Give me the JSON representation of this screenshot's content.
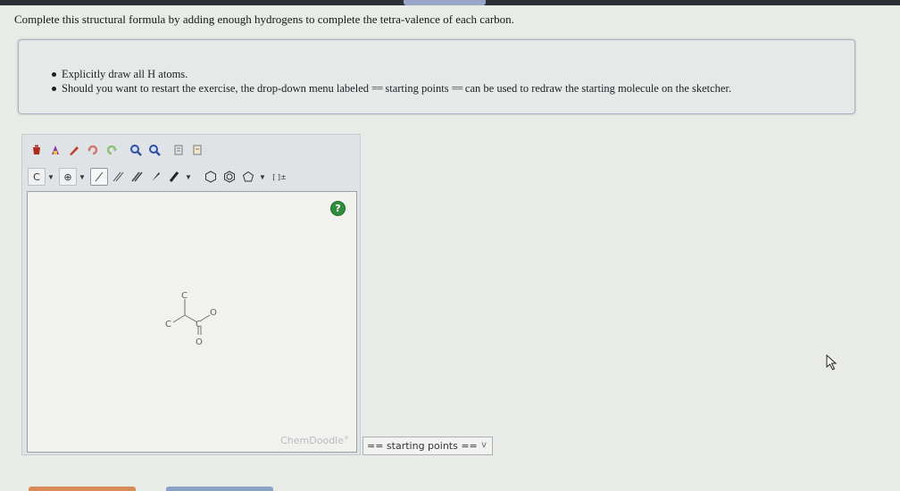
{
  "instruction": "Complete this structural formula by adding enough hydrogens to complete the tetra-valence of each carbon.",
  "info": {
    "bullet1": "Explicitly draw all H atoms.",
    "bullet2_pre": "Should you want to restart the exercise, the drop-down menu labeled ",
    "bullet2_eq1": "==",
    "bullet2_mid": " starting points ",
    "bullet2_eq2": "==",
    "bullet2_post": " can be used to redraw the starting molecule on the sketcher."
  },
  "toolbar": {
    "atom_label": "C",
    "charge_label": "⊕",
    "bracket_label": "[ ]±"
  },
  "canvas": {
    "help_label": "?",
    "atoms": [
      "C",
      "C",
      "C",
      "O",
      "O"
    ],
    "watermark": "ChemDoodle"
  },
  "dropdown": {
    "selected": "== starting points ==",
    "chevron": "v"
  },
  "colors": {
    "help_green": "#2f8e3c",
    "accent_orange": "#d98b57",
    "accent_blue": "#8aa0c4"
  }
}
